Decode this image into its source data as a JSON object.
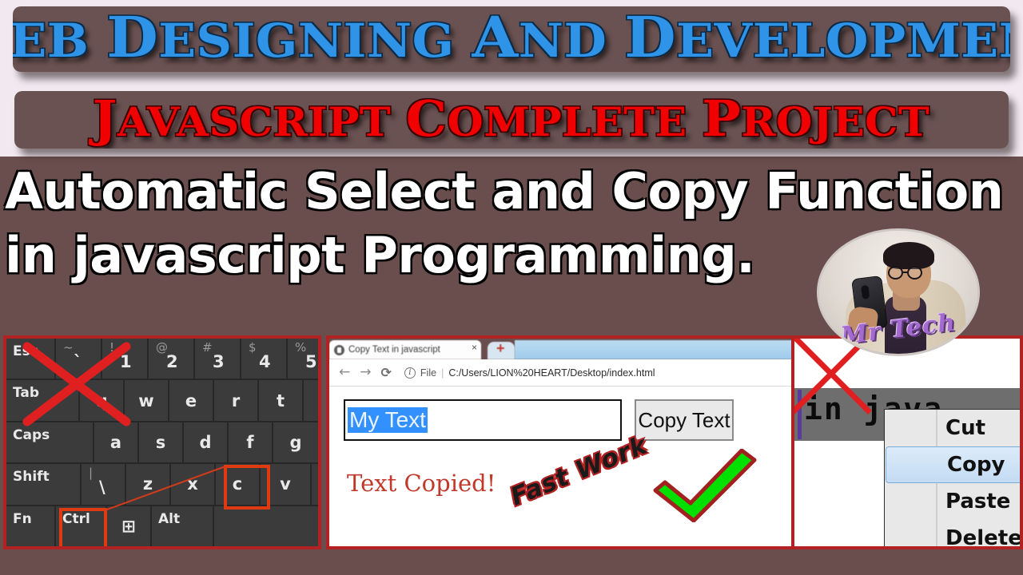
{
  "colors": {
    "page_bg": "#f1e8f0",
    "body_brown": "#6a4e4e",
    "banner_brown": "#6b5252",
    "title_blue": "#2f93e8",
    "title_red": "#f00000",
    "headline_white": "#ffffff",
    "panel_border_red": "#b22222",
    "key_highlight_orange": "#e03a12",
    "selection_blue": "#3390ff",
    "check_green": "#00e000",
    "brand_purple": "#a56ad0",
    "menu_selected_blue": "#c3dcf4"
  },
  "banner": {
    "line1": "Web Designing and development",
    "line2": "Javascript Complete Project"
  },
  "headline": {
    "line1": "Automatic Select and Copy Function",
    "line2": "in javascript Programming."
  },
  "avatar": {
    "brand": "Mr Tech",
    "alt": "channel-host-selfie"
  },
  "keyboard": {
    "xmark": "red-cross-over-esc-tab-area",
    "highlights": [
      "c",
      "Ctrl"
    ],
    "arrow": "red-line-from-ctrl-to-c",
    "rows": [
      [
        {
          "label": "Esc",
          "type": "label",
          "w": 62
        },
        {
          "sup": "~",
          "sub": "`",
          "type": "dual",
          "w": 58
        },
        {
          "sup": "!",
          "sub": "1",
          "type": "dual",
          "w": 58
        },
        {
          "sup": "@",
          "sub": "2",
          "type": "dual",
          "w": 58
        },
        {
          "sup": "#",
          "sub": "3",
          "type": "dual",
          "w": 58
        },
        {
          "sup": "$",
          "sub": "4",
          "type": "dual",
          "w": 58
        },
        {
          "sup": "%",
          "sub": "5",
          "type": "dual",
          "w": 44
        }
      ],
      [
        {
          "label": "Tab",
          "type": "label",
          "w": 92
        },
        {
          "mid": "q",
          "type": "mid",
          "w": 56
        },
        {
          "mid": "w",
          "type": "mid",
          "w": 56
        },
        {
          "mid": "e",
          "type": "mid",
          "w": 56
        },
        {
          "mid": "r",
          "type": "mid",
          "w": 56
        },
        {
          "mid": "t",
          "type": "mid",
          "w": 56
        },
        {
          "mid": "",
          "type": "mid",
          "w": 24
        }
      ],
      [
        {
          "label": "Caps",
          "type": "label",
          "w": 110
        },
        {
          "mid": "a",
          "type": "mid",
          "w": 56
        },
        {
          "mid": "s",
          "type": "mid",
          "w": 56
        },
        {
          "mid": "d",
          "type": "mid",
          "w": 56
        },
        {
          "mid": "f",
          "type": "mid",
          "w": 56
        },
        {
          "mid": "g",
          "type": "mid",
          "w": 58
        }
      ],
      [
        {
          "label": "Shift",
          "type": "label",
          "w": 94
        },
        {
          "sup": "|",
          "sub": "\\",
          "type": "dual",
          "w": 56
        },
        {
          "mid": "z",
          "type": "mid",
          "w": 56
        },
        {
          "mid": "x",
          "type": "mid",
          "w": 56
        },
        {
          "mid": "c",
          "type": "mid",
          "w": 56
        },
        {
          "mid": "v",
          "type": "mid",
          "w": 64
        }
      ],
      [
        {
          "label": "Fn",
          "type": "label",
          "w": 62
        },
        {
          "label": "Ctrl",
          "type": "label",
          "w": 64
        },
        {
          "mid": "⊞",
          "type": "mid",
          "w": 56
        },
        {
          "label": "Alt",
          "type": "label",
          "w": 78
        },
        {
          "mid": "",
          "type": "mid",
          "w": 132
        }
      ]
    ]
  },
  "browser": {
    "tab_title": "Copy Text in javascript",
    "tab_close": "×",
    "new_tab": "+",
    "nav": {
      "back": "←",
      "forward": "→",
      "reload": "⟳"
    },
    "omnibox": {
      "info_icon": "i",
      "scheme_label": "File",
      "divider": "|",
      "url": "C:/Users/LION%20HEART/Desktop/index.html"
    },
    "page": {
      "input_value": "My Text",
      "input_state": "selected",
      "button_label": "Copy Text",
      "status_message": "Text Copied!",
      "annotation": "Fast Work",
      "check_icon": "green-checkmark"
    }
  },
  "context_menu": {
    "xmark": "red-cross-over-white-area",
    "code_snippet": "in java",
    "items": [
      {
        "label": "Cut",
        "selected": false
      },
      {
        "label": "Copy",
        "selected": true
      },
      {
        "label": "Paste",
        "selected": false
      },
      {
        "label": "Delete",
        "selected": false
      }
    ]
  }
}
